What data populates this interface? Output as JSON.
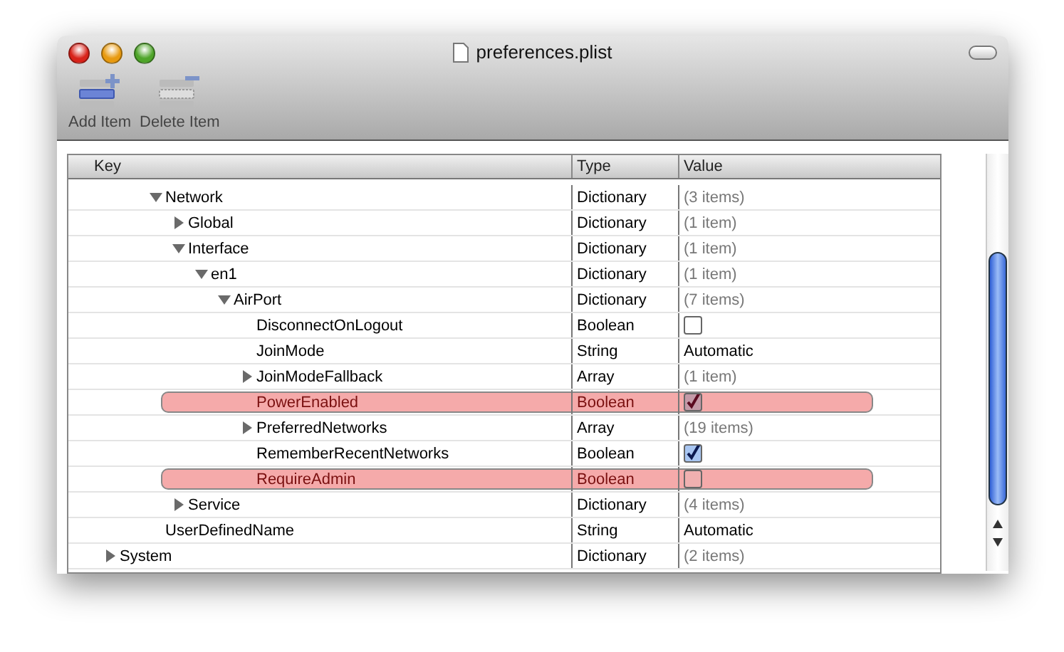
{
  "window": {
    "title": "preferences.plist"
  },
  "toolbar": [
    {
      "label": "Add Item",
      "kind": "add"
    },
    {
      "label": "Delete Item",
      "kind": "delete"
    }
  ],
  "table": {
    "columns": [
      "Key",
      "Type",
      "Value"
    ],
    "rows": [
      {
        "children": [
          {
            "children": [
              {
                "key": "Network",
                "type": "Dictionary",
                "value": "(3 items)",
                "kind": "count",
                "expanded": true,
                "flagged": false,
                "children": [
                  {
                    "key": "Global",
                    "type": "Dictionary",
                    "value": "(1 item)",
                    "kind": "count",
                    "expanded": false,
                    "flagged": false
                  },
                  {
                    "key": "Interface",
                    "type": "Dictionary",
                    "value": "(1 item)",
                    "kind": "count",
                    "expanded": true,
                    "flagged": false,
                    "children": [
                      {
                        "key": "en1",
                        "type": "Dictionary",
                        "value": "(1 item)",
                        "kind": "count",
                        "expanded": true,
                        "flagged": false,
                        "children": [
                          {
                            "key": "AirPort",
                            "type": "Dictionary",
                            "value": "(7 items)",
                            "kind": "count",
                            "expanded": true,
                            "flagged": false,
                            "children": [
                              {
                                "key": "DisconnectOnLogout",
                                "type": "Boolean",
                                "kind": "checkbox",
                                "checked": false,
                                "flagged": false
                              },
                              {
                                "key": "JoinMode",
                                "type": "String",
                                "value": "Automatic",
                                "kind": "string",
                                "flagged": false
                              },
                              {
                                "key": "JoinModeFallback",
                                "type": "Array",
                                "value": "(1 item)",
                                "kind": "count",
                                "expanded": false,
                                "flagged": false
                              },
                              {
                                "key": "PowerEnabled",
                                "type": "Boolean",
                                "kind": "checkbox",
                                "checked": true,
                                "flagged": true
                              },
                              {
                                "key": "PreferredNetworks",
                                "type": "Array",
                                "value": "(19 items)",
                                "kind": "count",
                                "expanded": false,
                                "flagged": false
                              },
                              {
                                "key": "RememberRecentNetworks",
                                "type": "Boolean",
                                "kind": "checkbox",
                                "checked": true,
                                "flagged": false
                              },
                              {
                                "key": "RequireAdmin",
                                "type": "Boolean",
                                "kind": "checkbox",
                                "checked": false,
                                "flagged": true
                              }
                            ]
                          }
                        ]
                      }
                    ]
                  },
                  {
                    "key": "Service",
                    "type": "Dictionary",
                    "value": "(4 items)",
                    "kind": "count",
                    "expanded": false,
                    "flagged": false
                  }
                ]
              },
              {
                "key": "UserDefinedName",
                "type": "String",
                "value": "Automatic",
                "kind": "string",
                "flagged": false
              }
            ]
          }
        ]
      },
      {
        "key": "System",
        "type": "Dictionary",
        "value": "(2 items)",
        "kind": "count",
        "expanded": false,
        "flagged": false
      }
    ]
  }
}
